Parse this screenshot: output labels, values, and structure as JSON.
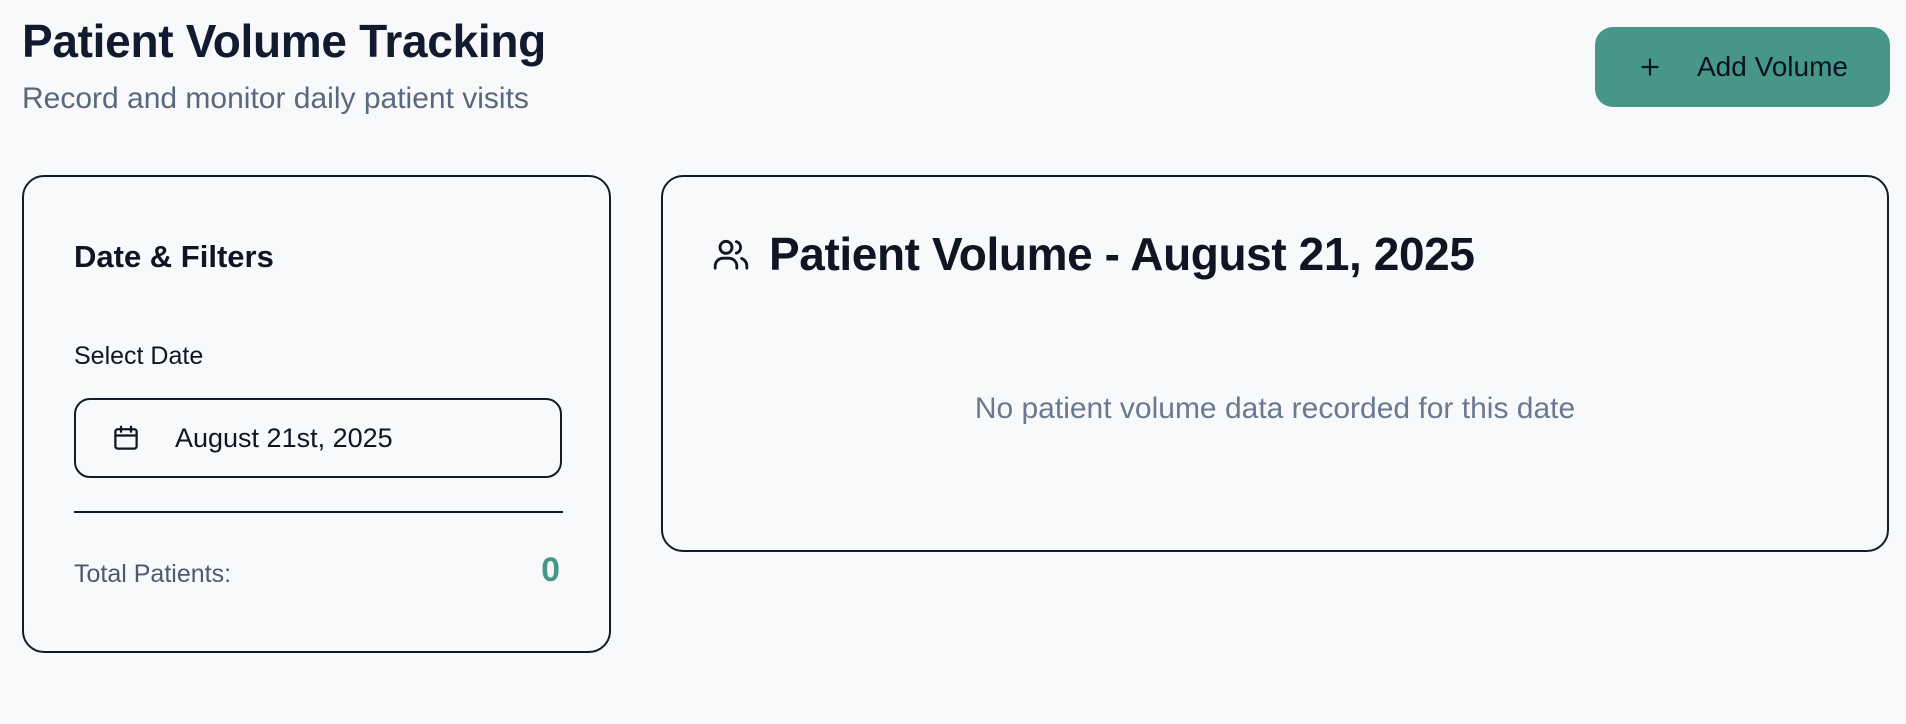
{
  "header": {
    "title": "Patient Volume Tracking",
    "subtitle": "Record and monitor daily patient visits",
    "add_button_label": "Add Volume",
    "add_button_icon": "plus-icon",
    "accent_color": "#47968a"
  },
  "filters": {
    "title": "Date & Filters",
    "date_label": "Select Date",
    "date_value": "August 21st, 2025",
    "date_icon": "calendar-icon",
    "total_label": "Total Patients:",
    "total_value": "0"
  },
  "volume": {
    "icon": "users-icon",
    "title": "Patient Volume - August 21, 2025",
    "empty_message": "No patient volume data recorded for this date"
  }
}
